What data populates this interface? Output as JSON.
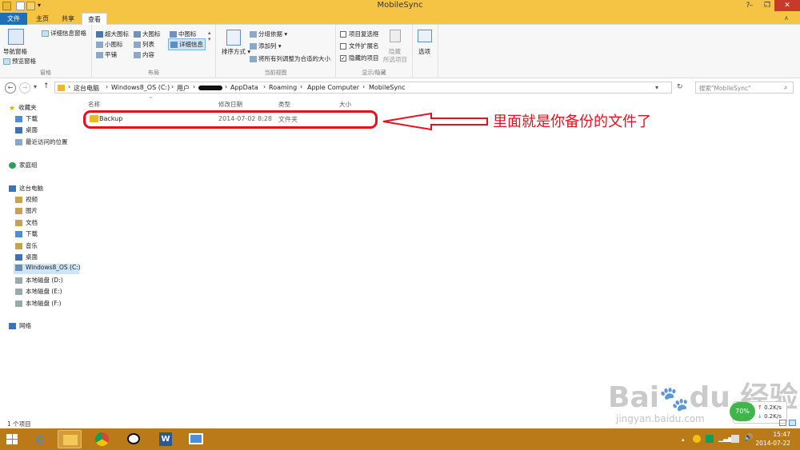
{
  "window": {
    "title": "MobileSync"
  },
  "tabs": {
    "file": "文件",
    "home": "主页",
    "share": "共享",
    "view": "查看"
  },
  "ribbon": {
    "pane": {
      "nav_pane": "导航窗格",
      "preview": "预览窗格",
      "details": "详细信息窗格",
      "group": "窗格"
    },
    "layout": {
      "xl": "超大图标",
      "large": "大图标",
      "medium": "中图标",
      "small": "小图标",
      "list": "列表",
      "details": "详细信息",
      "tiles": "平铺",
      "content": "内容",
      "group": "布局"
    },
    "current": {
      "sort": "排序方式",
      "groupby": "分组依据",
      "addcol": "添加列",
      "fitcols": "将所有列调整为合适的大小",
      "group": "当前视图"
    },
    "showhide": {
      "itemcheck": "项目复选框",
      "ext": "文件扩展名",
      "hidden": "隐藏的项目",
      "hide": "隐藏",
      "hide_sel": "所选项目",
      "group": "显示/隐藏"
    },
    "options": {
      "label": "选项"
    }
  },
  "address": {
    "crumbs": [
      "这台电脑",
      "Windows8_OS (C:)",
      "用户",
      "",
      "AppData",
      "Roaming",
      "Apple Computer",
      "MobileSync"
    ],
    "search_placeholder": "搜索\"MobileSync\""
  },
  "nav": {
    "favorites": "收藏夹",
    "downloads": "下载",
    "desktop": "桌面",
    "recent": "最近访问的位置",
    "homegroup": "家庭组",
    "thispc": "这台电脑",
    "videos": "视频",
    "pictures": "图片",
    "documents": "文档",
    "downloads2": "下载",
    "music": "音乐",
    "desktop2": "桌面",
    "c": "Windows8_OS (C:)",
    "d": "本地磁盘 (D:)",
    "e": "本地磁盘 (E:)",
    "f": "本地磁盘 (F:)",
    "network": "网络"
  },
  "columns": {
    "name": "名称",
    "modified": "修改日期",
    "type": "类型",
    "size": "大小"
  },
  "file": {
    "name": "Backup",
    "modified": "2014-07-02 8:28",
    "type": "文件夹"
  },
  "annotation": "里面就是你备份的文件了",
  "status": "1 个项目",
  "tray": {
    "time": "15:47",
    "date": "2014-07-22",
    "up": "0.2K/s",
    "down": "0.2K/s",
    "gauge": "70%"
  },
  "watermark": {
    "logo": "Bai du 经验",
    "url": "jingyan.baidu.com"
  },
  "colors": {
    "accent": "#1d6fb8",
    "titlebar": "#f5c445",
    "annotation": "#e8101e",
    "taskbar": "#bb7a18"
  }
}
